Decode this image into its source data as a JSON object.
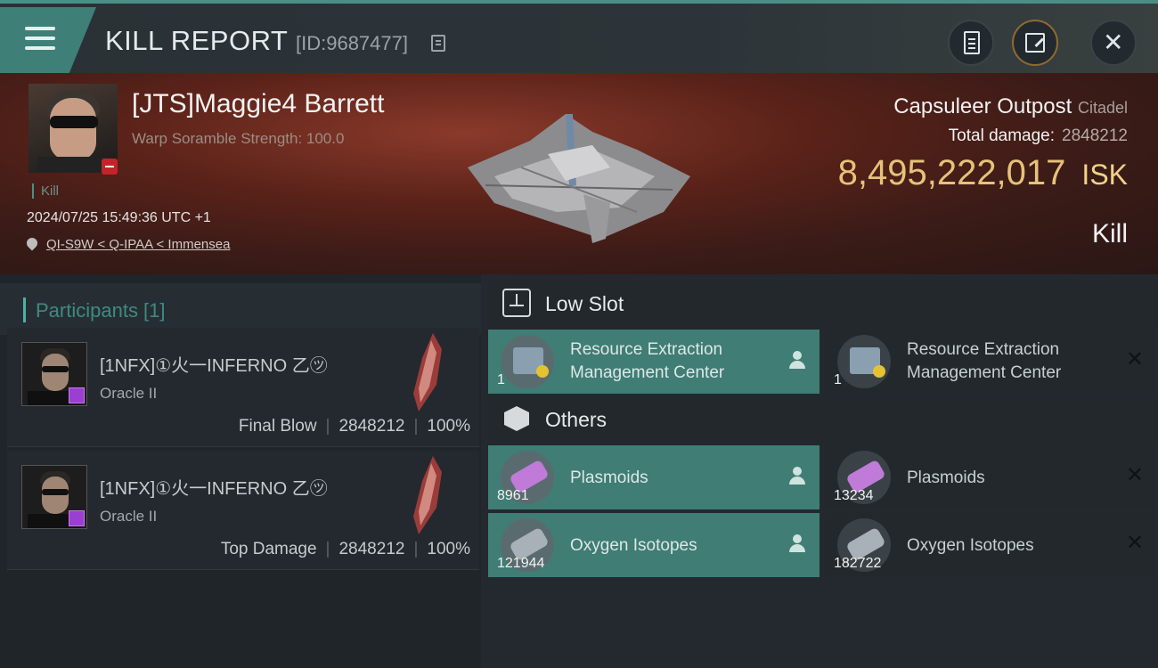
{
  "header": {
    "title": "KILL REPORT",
    "report_id": "[ID:9687477]",
    "icons": [
      "menu-icon",
      "copy-icon",
      "clipboard-icon",
      "share-icon",
      "close-icon"
    ]
  },
  "victim": {
    "name": "[JTS]Maggie4 Barrett",
    "warp_scramble": "Warp Soramble Strength: 100.0",
    "tag": "Kill",
    "datetime": "2024/07/25 15:49:36 UTC +1",
    "location": "QI-S9W < Q-IPAA < Immensea"
  },
  "target": {
    "name": "Capsuleer Outpost",
    "class": "Citadel",
    "total_damage_label": "Total damage:",
    "total_damage": "2848212",
    "isk_value": "8,495,222,017",
    "isk_unit": "ISK",
    "result": "Kill"
  },
  "participants": {
    "title": "Participants [1]",
    "rows": [
      {
        "name": "[1NFX]①火一INFERNO 乙㋡",
        "ship": "Oracle II",
        "role": "Final Blow",
        "damage": "2848212",
        "percent": "100%"
      },
      {
        "name": "[1NFX]①火一INFERNO 乙㋡",
        "ship": "Oracle II",
        "role": "Top Damage",
        "damage": "2848212",
        "percent": "100%"
      }
    ]
  },
  "loot": {
    "low_slot_title": "Low Slot",
    "others_title": "Others",
    "low_slot": [
      {
        "name": "Resource Extraction Management Center",
        "qty": "1",
        "dropped": true
      },
      {
        "name": "Resource Extraction Management Center",
        "qty": "1",
        "dropped": false
      }
    ],
    "others": [
      {
        "name": "Plasmoids",
        "qty": "8961",
        "dropped": true
      },
      {
        "name": "Plasmoids",
        "qty": "13234",
        "dropped": false
      },
      {
        "name": "Oxygen Isotopes",
        "qty": "121944",
        "dropped": true
      },
      {
        "name": "Oxygen Isotopes",
        "qty": "182722",
        "dropped": false
      }
    ]
  },
  "colors": {
    "accent": "#3e7f78",
    "isk": "#e6c27a",
    "highlight_row": "#3f7d75"
  }
}
